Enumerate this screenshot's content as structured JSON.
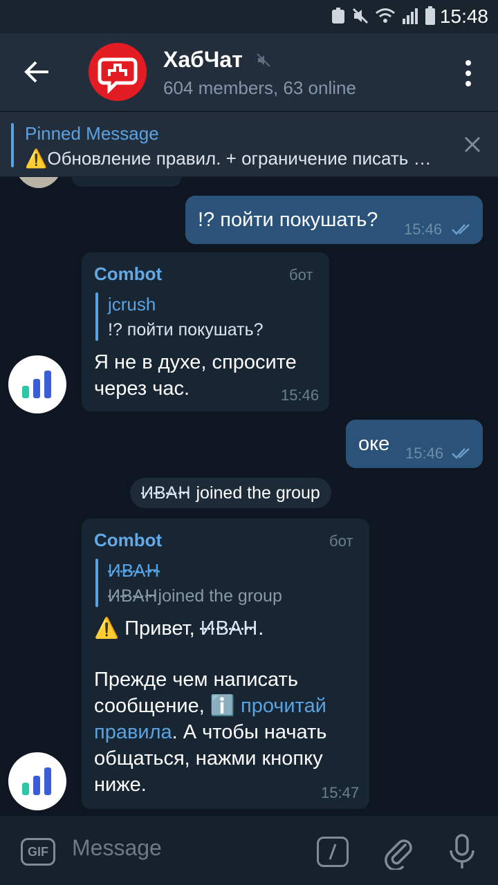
{
  "status_bar": {
    "time": "15:48"
  },
  "header": {
    "title": "ХабЧат",
    "subtitle": "604 members, 63 online"
  },
  "pinned": {
    "label": "Pinned Message",
    "text": "⚠️Обновление правил.  + ограничение писать в группу новым участникам"
  },
  "messages": [
    {
      "type": "outgoing",
      "text": "!? пойти покушать?",
      "time": "15:46"
    },
    {
      "type": "incoming",
      "sender": "Combot",
      "tag": "бот",
      "reply_name": "jcrush",
      "reply_text": "!? пойти покушать?",
      "text_line1": "Я не в духе, спросите",
      "text_line2": "через час.",
      "time": "15:46"
    },
    {
      "type": "outgoing",
      "text": "оке",
      "time": "15:46"
    },
    {
      "type": "service",
      "user": "ИВАН",
      "text": "joined the group"
    },
    {
      "type": "incoming",
      "sender": "Combot",
      "tag": "бот",
      "reply_name": "ИВАН",
      "reply_user": "ИВАН",
      "reply_text": "joined the group",
      "greet_prefix": "⚠️ Привет, ",
      "greet_user": "ИВАН",
      "greet_suffix": ".",
      "line1": "Прежде чем написать",
      "line2_prefix": "сообщение, ",
      "info_icon": "ℹ️",
      "link1": "прочитай",
      "link2": "правила",
      "line3_suffix": ". А чтобы начать",
      "line4": "общаться, нажми кнопку",
      "line5": "ниже.",
      "time": "15:47"
    }
  ],
  "composer": {
    "gif_label": "GIF",
    "placeholder": "Message"
  },
  "colors": {
    "accent": "#5aa3e2",
    "outgoing_bubble": "#2b5278",
    "incoming_bubble": "#182533",
    "background": "#0e1621"
  },
  "icons": [
    "back-arrow-icon",
    "mute-icon",
    "more-vertical-icon",
    "close-icon",
    "read-check-icon",
    "bot-chart-icon",
    "gif-icon",
    "command-icon",
    "paperclip-icon",
    "microphone-icon"
  ]
}
